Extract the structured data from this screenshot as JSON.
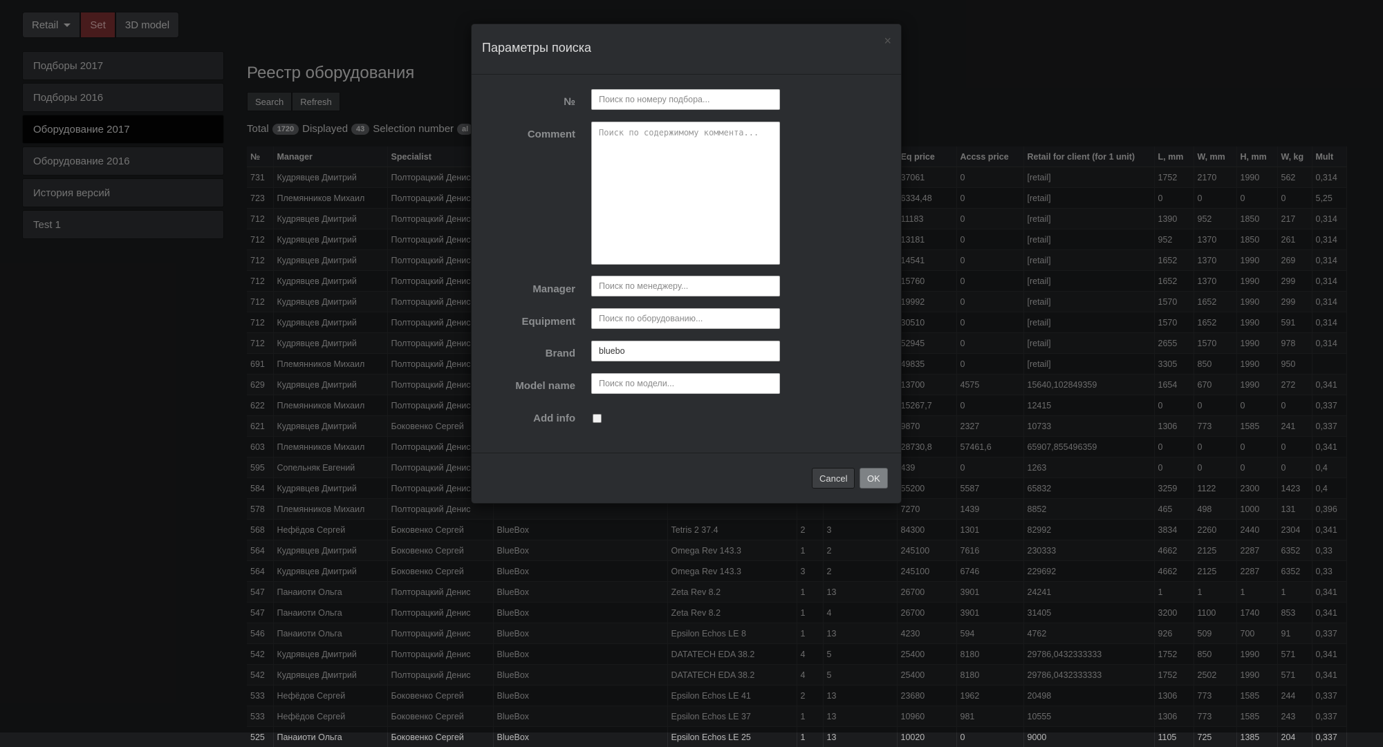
{
  "toolbar": {
    "retail_label": "Retail",
    "set_label": "Set",
    "model3d_label": "3D model"
  },
  "sidebar": {
    "items": [
      {
        "label": "Подборы 2017"
      },
      {
        "label": "Подборы 2016"
      },
      {
        "label": "Оборудование 2017"
      },
      {
        "label": "Оборудование 2016"
      },
      {
        "label": "История версий"
      },
      {
        "label": "Test 1"
      }
    ]
  },
  "main": {
    "title": "Реестр оборудования",
    "search_label": "Search",
    "refresh_label": "Refresh",
    "total_label": "Total",
    "total_value": "1720",
    "displayed_label": "Displayed",
    "displayed_value": "43",
    "selection_label": "Selection number",
    "selection_value": "al"
  },
  "table": {
    "headers": [
      "№",
      "Manager",
      "Specialist",
      "",
      "",
      "",
      "",
      "Eq price",
      "Accss price",
      "Retail for client (for 1 unit)",
      "L, mm",
      "W, mm",
      "H, mm",
      "W, kg",
      "Mult"
    ],
    "rows": [
      [
        "731",
        "Кудрявцев Дмитрий",
        "Полторацкий Денис",
        "",
        "",
        "",
        "",
        "37061",
        "0",
        "[retail]",
        "1752",
        "2170",
        "1990",
        "562",
        "0,314"
      ],
      [
        "723",
        "Племянников Михаил",
        "Полторацкий Денис",
        "",
        "",
        "",
        "",
        "6334,48",
        "0",
        "[retail]",
        "0",
        "0",
        "0",
        "0",
        "5,25"
      ],
      [
        "712",
        "Кудрявцев Дмитрий",
        "Полторацкий Денис",
        "",
        "",
        "",
        "",
        "11183",
        "0",
        "[retail]",
        "1390",
        "952",
        "1850",
        "217",
        "0,314"
      ],
      [
        "712",
        "Кудрявцев Дмитрий",
        "Полторацкий Денис",
        "",
        "",
        "",
        "",
        "13181",
        "0",
        "[retail]",
        "952",
        "1370",
        "1850",
        "261",
        "0,314"
      ],
      [
        "712",
        "Кудрявцев Дмитрий",
        "Полторацкий Денис",
        "",
        "",
        "",
        "",
        "14541",
        "0",
        "[retail]",
        "1652",
        "1370",
        "1990",
        "269",
        "0,314"
      ],
      [
        "712",
        "Кудрявцев Дмитрий",
        "Полторацкий Денис",
        "",
        "",
        "",
        "",
        "15760",
        "0",
        "[retail]",
        "1652",
        "1370",
        "1990",
        "299",
        "0,314"
      ],
      [
        "712",
        "Кудрявцев Дмитрий",
        "Полторацкий Денис",
        "",
        "",
        "",
        "",
        "19992",
        "0",
        "[retail]",
        "1570",
        "1652",
        "1990",
        "299",
        "0,314"
      ],
      [
        "712",
        "Кудрявцев Дмитрий",
        "Полторацкий Денис",
        "",
        "",
        "",
        "",
        "30510",
        "0",
        "[retail]",
        "1570",
        "1652",
        "1990",
        "591",
        "0,314"
      ],
      [
        "712",
        "Кудрявцев Дмитрий",
        "Полторацкий Денис",
        "",
        "",
        "",
        "",
        "52945",
        "0",
        "[retail]",
        "2655",
        "1570",
        "1990",
        "978",
        "0,314"
      ],
      [
        "691",
        "Племянников Михаил",
        "Полторацкий Денис",
        "",
        "",
        "",
        "",
        "49835",
        "0",
        "[retail]",
        "3305",
        "850",
        "1990",
        "950",
        ""
      ],
      [
        "629",
        "Кудрявцев Дмитрий",
        "Полторацкий Денис",
        "",
        "",
        "",
        "",
        "13700",
        "4575",
        "15640,102849359",
        "1654",
        "670",
        "1990",
        "272",
        "0,341"
      ],
      [
        "622",
        "Племянников Михаил",
        "Полторацкий Денис",
        "",
        "",
        "",
        "",
        "15267,7",
        "0",
        "12415",
        "0",
        "0",
        "0",
        "0",
        "0,337"
      ],
      [
        "621",
        "Кудрявцев Дмитрий",
        "Боковенко Сергей",
        "",
        "",
        "",
        "",
        "9870",
        "2327",
        "10733",
        "1306",
        "773",
        "1585",
        "241",
        "0,337"
      ],
      [
        "603",
        "Племянников Михаил",
        "Полторацкий Денис",
        "",
        "",
        "",
        "",
        "28730,8",
        "57461,6",
        "65907,855496359",
        "0",
        "0",
        "0",
        "0",
        "0,341"
      ],
      [
        "595",
        "Сопельняк Евгений",
        "Полторацкий Денис",
        "",
        "",
        "",
        "",
        "439",
        "0",
        "1263",
        "0",
        "0",
        "0",
        "0",
        "0,4"
      ],
      [
        "584",
        "Кудрявцев Дмитрий",
        "Полторацкий Денис",
        "",
        "",
        "",
        "",
        "55200",
        "5587",
        "65832",
        "3259",
        "1122",
        "2300",
        "1423",
        "0,4"
      ],
      [
        "578",
        "Племянников Михаил",
        "Полторацкий Денис",
        "",
        "",
        "",
        "",
        "7270",
        "1439",
        "8852",
        "465",
        "498",
        "1000",
        "131",
        "0,396"
      ],
      [
        "568",
        "Нефёдов Сергей",
        "Боковенко Сергей",
        "BlueBox",
        "Tetris 2 37.4",
        "2",
        "3",
        "84300",
        "1301",
        "82992",
        "3834",
        "2260",
        "2440",
        "2304",
        "0,341"
      ],
      [
        "564",
        "Кудрявцев Дмитрий",
        "Боковенко Сергей",
        "BlueBox",
        "Omega Rev 143.3",
        "1",
        "2",
        "245100",
        "7616",
        "230333",
        "4662",
        "2125",
        "2287",
        "6352",
        "0,33"
      ],
      [
        "564",
        "Кудрявцев Дмитрий",
        "Боковенко Сергей",
        "BlueBox",
        "Omega Rev 143.3",
        "3",
        "2",
        "245100",
        "6746",
        "229692",
        "4662",
        "2125",
        "2287",
        "6352",
        "0,33"
      ],
      [
        "547",
        "Панаиоти Ольга",
        "Полторацкий Денис",
        "BlueBox",
        "Zeta Rev 8.2",
        "1",
        "13",
        "26700",
        "3901",
        "24241",
        "1",
        "1",
        "1",
        "1",
        "0,341"
      ],
      [
        "547",
        "Панаиоти Ольга",
        "Полторацкий Денис",
        "BlueBox",
        "Zeta Rev 8.2",
        "1",
        "4",
        "26700",
        "3901",
        "31405",
        "3200",
        "1100",
        "1740",
        "853",
        "0,341"
      ],
      [
        "546",
        "Панаиоти Ольга",
        "Полторацкий Денис",
        "BlueBox",
        "Epsilon Echos LE 8",
        "1",
        "13",
        "4230",
        "594",
        "4762",
        "926",
        "509",
        "700",
        "91",
        "0,337"
      ],
      [
        "542",
        "Кудрявцев Дмитрий",
        "Полторацкий Денис",
        "BlueBox",
        "DATATECH EDA 38.2",
        "4",
        "5",
        "25400",
        "8180",
        "29786,0432333333",
        "1752",
        "850",
        "1990",
        "571",
        "0,341"
      ],
      [
        "542",
        "Кудрявцев Дмитрий",
        "Полторацкий Денис",
        "BlueBox",
        "DATATECH EDA 38.2",
        "4",
        "5",
        "25400",
        "8180",
        "29786,0432333333",
        "1752",
        "2502",
        "1990",
        "571",
        "0,341"
      ],
      [
        "533",
        "Нефёдов Сергей",
        "Боковенко Сергей",
        "BlueBox",
        "Epsilon Echos LE 41",
        "2",
        "13",
        "23680",
        "1962",
        "20498",
        "1306",
        "773",
        "1585",
        "244",
        "0,337"
      ],
      [
        "533",
        "Нефёдов Сергей",
        "Боковенко Сергей",
        "BlueBox",
        "Epsilon Echos LE 37",
        "1",
        "13",
        "10960",
        "981",
        "10555",
        "1306",
        "773",
        "1585",
        "243",
        "0,337"
      ],
      [
        "525",
        "Панаиоти Ольга",
        "Боковенко Сергей",
        "BlueBox",
        "Epsilon Echos LE 25",
        "1",
        "13",
        "10020",
        "0",
        "9000",
        "1105",
        "725",
        "1385",
        "204",
        "0,337"
      ]
    ]
  },
  "modal": {
    "title": "Параметры поиска",
    "close_glyph": "×",
    "number_label": "№",
    "number_placeholder": "Поиск по номеру подбора...",
    "comment_label": "Comment",
    "comment_placeholder": "Поиск по содержимому коммента...",
    "manager_label": "Manager",
    "manager_placeholder": "Поиск по менеджеру...",
    "equipment_label": "Equipment",
    "equipment_placeholder": "Поиск по оборудованию...",
    "brand_label": "Brand",
    "brand_value": "bluebo",
    "model_label": "Model name",
    "model_placeholder": "Поиск по модели...",
    "addinfo_label": "Add info",
    "addinfo_checked": false,
    "cancel_label": "Cancel",
    "ok_label": "OK"
  }
}
